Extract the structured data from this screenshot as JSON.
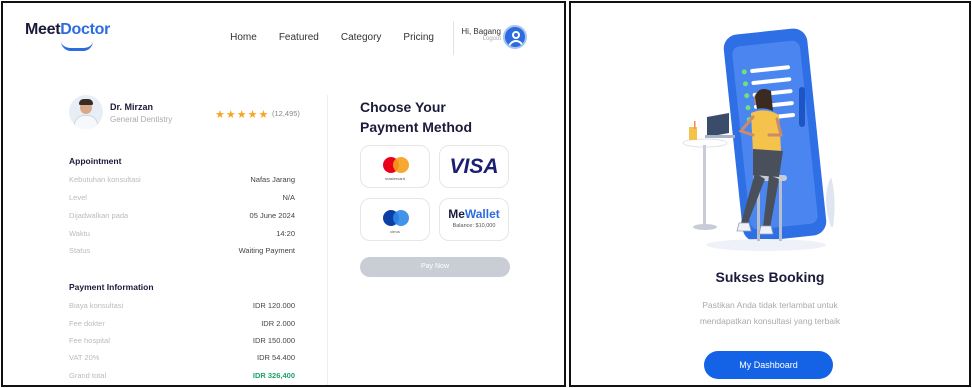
{
  "nav": {
    "logo_part1": "Meet",
    "logo_part2": "Doctor",
    "links": [
      "Home",
      "Featured",
      "Category",
      "Pricing"
    ],
    "greeting": "Hi, Bagang",
    "logout": "Logout"
  },
  "doctor": {
    "name": "Dr. Mirzan",
    "specialty": "General Dentistry",
    "stars": "★★★★★",
    "rating_count": "(12,495)"
  },
  "appointment": {
    "title": "Appointment",
    "rows": [
      {
        "label": "Kebutuhan konsultasi",
        "value": "Nafas Jarang"
      },
      {
        "label": "Level",
        "value": "N/A"
      },
      {
        "label": "Dijadwalkan pada",
        "value": "05 June 2024"
      },
      {
        "label": "Waktu",
        "value": "14:20"
      },
      {
        "label": "Status",
        "value": "Waiting Payment"
      }
    ]
  },
  "payment_info": {
    "title": "Payment Information",
    "rows": [
      {
        "label": "Biaya konsultasi",
        "value": "IDR 120.000"
      },
      {
        "label": "Fee dokter",
        "value": "IDR 2.000"
      },
      {
        "label": "Fee hospital",
        "value": "IDR 150.000"
      },
      {
        "label": "VAT 20%",
        "value": "IDR 54.400"
      },
      {
        "label": "Grand total",
        "value": "IDR 326,400"
      }
    ]
  },
  "payment_method": {
    "title": "Choose Your Payment Method",
    "mastercard_label": "mastercard",
    "visa_label": "VISA",
    "maestro_label": "cirrus",
    "mewallet_part1": "Me",
    "mewallet_part2": "Wallet",
    "mewallet_balance": "Balance: $10,000",
    "pay_button": "Pay Now"
  },
  "success": {
    "title": "Sukses Booking",
    "line1": "Pastikan Anda tidak terlambat untuk",
    "line2": "mendapatkan konsultasi yang terbaik",
    "button": "My Dashboard"
  },
  "colors": {
    "brand": "#2d6cdf",
    "primary_button": "#1463e6",
    "star": "#f5a623",
    "total_green": "#1ca36a",
    "disabled_button": "#c9cdd6"
  }
}
